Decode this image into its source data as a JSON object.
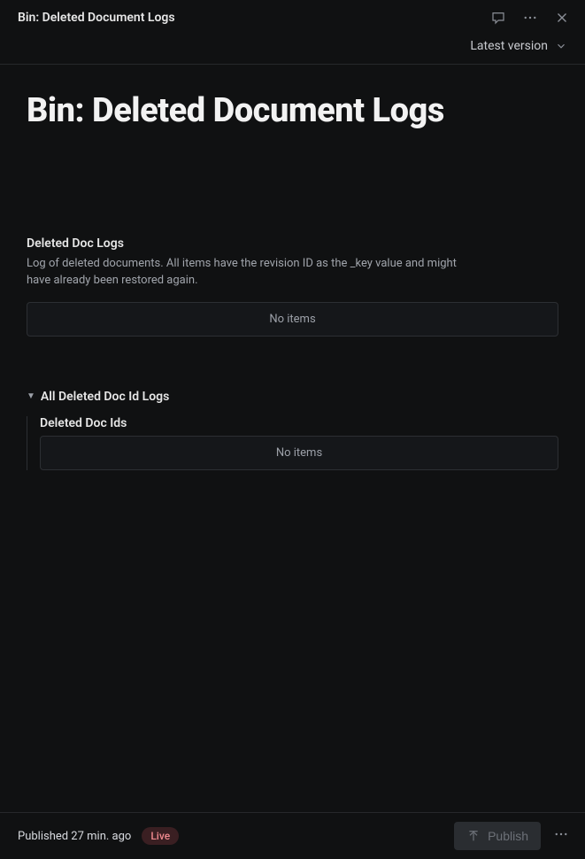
{
  "header": {
    "title": "Bin: Deleted Document Logs"
  },
  "version": {
    "label": "Latest version"
  },
  "page": {
    "title": "Bin: Deleted Document Logs"
  },
  "section1": {
    "label": "Deleted Doc Logs",
    "description": "Log of deleted documents. All items have the revision ID as the _key value and might have already been restored again.",
    "empty": "No items"
  },
  "section2": {
    "collapse_label": "All Deleted Doc Id Logs",
    "sub_label": "Deleted Doc Ids",
    "empty": "No items"
  },
  "footer": {
    "published_text": "Published 27 min. ago",
    "live_badge": "Live",
    "publish_label": "Publish"
  }
}
